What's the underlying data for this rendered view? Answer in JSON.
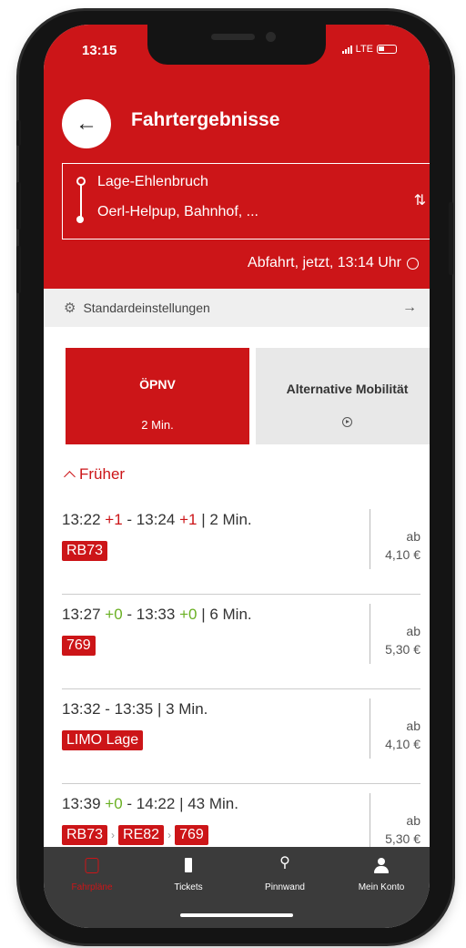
{
  "status_bar": {
    "time": "13:15",
    "network": "LTE"
  },
  "header": {
    "title": "Fahrtergebnisse",
    "back_icon": "arrow-left-icon",
    "route": {
      "from": "Lage-Ehlenbruch",
      "to": "Oerl-Helpup, Bahnhof, ..."
    },
    "departure": "Abfahrt, jetzt, 13:14 Uhr"
  },
  "settings": {
    "label": "Standardeinstellungen"
  },
  "mode_tabs": [
    {
      "label": "ÖPNV",
      "sub": "2 Min.",
      "active": true
    },
    {
      "label": "Alternative Mobilität",
      "active": false
    }
  ],
  "earlier_label": "Früher",
  "connections": [
    {
      "dep": "13:22",
      "dep_delay": "+1",
      "arr": "13:24",
      "arr_delay": "+1",
      "duration": "| 2 Min.",
      "lines": [
        "RB73"
      ],
      "price_prefix": "ab",
      "price": "4,10 €"
    },
    {
      "dep": "13:27",
      "dep_delay": "+0",
      "arr": "13:33",
      "arr_delay": "+0",
      "duration": "| 6 Min.",
      "lines": [
        "769"
      ],
      "price_prefix": "ab",
      "price": "5,30 €"
    },
    {
      "dep": "13:32",
      "dep_delay": "",
      "arr": "13:35",
      "arr_delay": "",
      "duration": "| 3 Min.",
      "lines": [
        "LIMO Lage"
      ],
      "price_prefix": "ab",
      "price": "4,10 €"
    },
    {
      "dep": "13:39",
      "dep_delay": "+0",
      "arr": "14:22",
      "arr_delay": "",
      "duration": "| 43 Min.",
      "lines": [
        "RB73",
        "RE82",
        "769"
      ],
      "price_prefix": "ab",
      "price": "5,30 €"
    }
  ],
  "bottom_nav": [
    {
      "label": "Fahrpläne",
      "icon": "home-icon",
      "active": true
    },
    {
      "label": "Tickets",
      "icon": "ticket-icon",
      "active": false
    },
    {
      "label": "Pinnwand",
      "icon": "pin-icon",
      "active": false
    },
    {
      "label": "Mein Konto",
      "icon": "user-icon",
      "active": false
    }
  ],
  "colors": {
    "brand_red": "#cc1518",
    "delay_late": "#cc1518",
    "delay_ontime": "#6ab023",
    "nav_bg": "#3b3b3b"
  }
}
